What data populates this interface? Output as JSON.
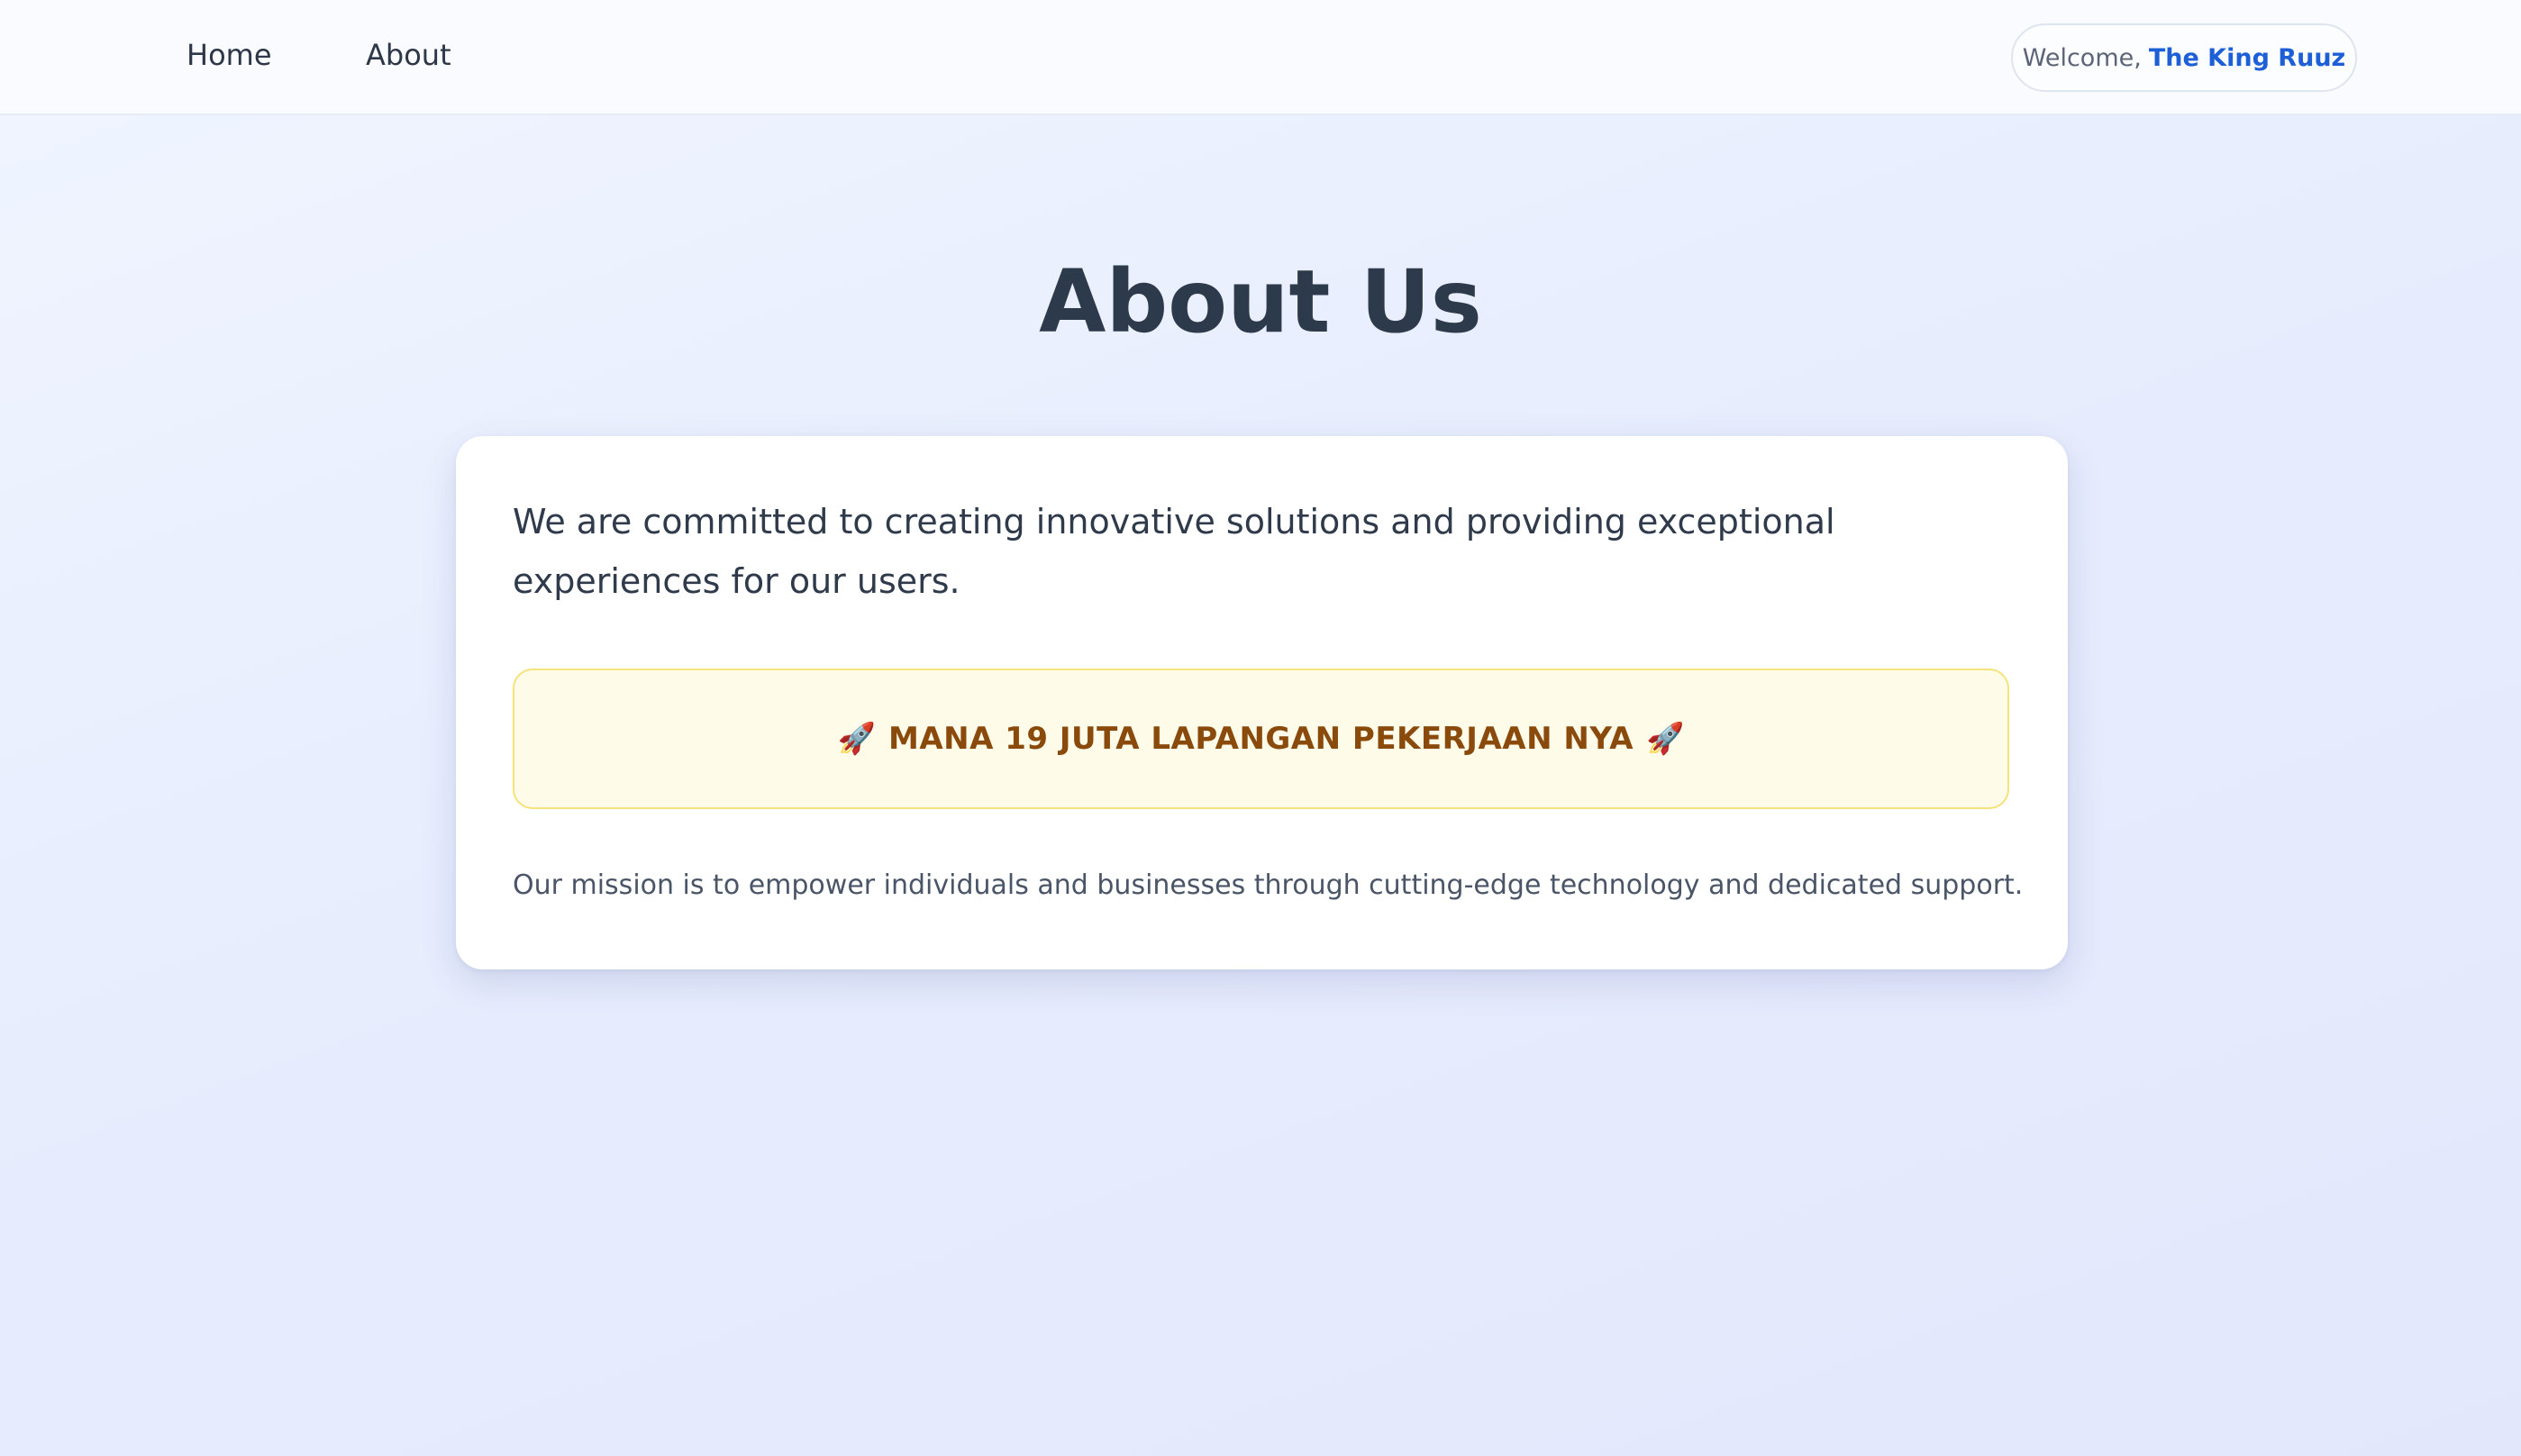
{
  "nav": {
    "home_label": "Home",
    "about_label": "About"
  },
  "user": {
    "welcome_prefix": "Welcome,",
    "name": "The King Ruuz"
  },
  "page": {
    "title": "About Us"
  },
  "card": {
    "intro": "We are committed to creating innovative solutions and providing exceptional experiences for our users.",
    "banner": {
      "icon": "rocket-icon",
      "glyph": "🚀",
      "text": "MANA 19 JUTA LAPANGAN PEKERJAAN NYA"
    },
    "mission": "Our mission is to empower individuals and businesses through cutting-edge technology and dedicated support."
  },
  "colors": {
    "accent": "#1d5fd6",
    "banner_bg": "#fefbe9",
    "banner_border": "#f6e27a",
    "banner_text": "#8a4a0c",
    "title": "#2d3a4b"
  }
}
